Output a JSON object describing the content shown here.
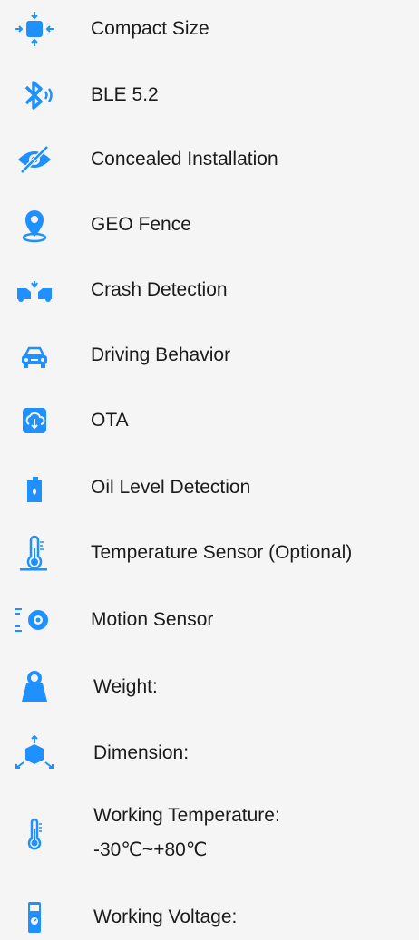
{
  "features": [
    {
      "label": "Compact Size",
      "icon": "compact-size-icon"
    },
    {
      "label": "BLE 5.2",
      "icon": "bluetooth-icon"
    },
    {
      "label": "Concealed Installation",
      "icon": "eye-slash-icon"
    },
    {
      "label": "GEO Fence",
      "icon": "location-pin-icon"
    },
    {
      "label": "Crash Detection",
      "icon": "crash-icon"
    },
    {
      "label": "Driving Behavior",
      "icon": "car-icon"
    },
    {
      "label": "OTA",
      "icon": "cloud-download-icon"
    },
    {
      "label": "Oil Level Detection",
      "icon": "oil-can-icon"
    },
    {
      "label": "Temperature Sensor (Optional)",
      "icon": "thermometer-icon"
    },
    {
      "label": "Motion Sensor",
      "icon": "motion-sensor-icon"
    }
  ],
  "specs": {
    "weight_label": "Weight:",
    "dimension_label": "Dimension:",
    "working_temp_label": "Working Temperature:",
    "working_temp_value": "-30℃~+80℃",
    "working_voltage_label": "Working Voltage:"
  },
  "colors": {
    "icon_blue": "#1e90ff",
    "text": "#1b1b1b"
  }
}
